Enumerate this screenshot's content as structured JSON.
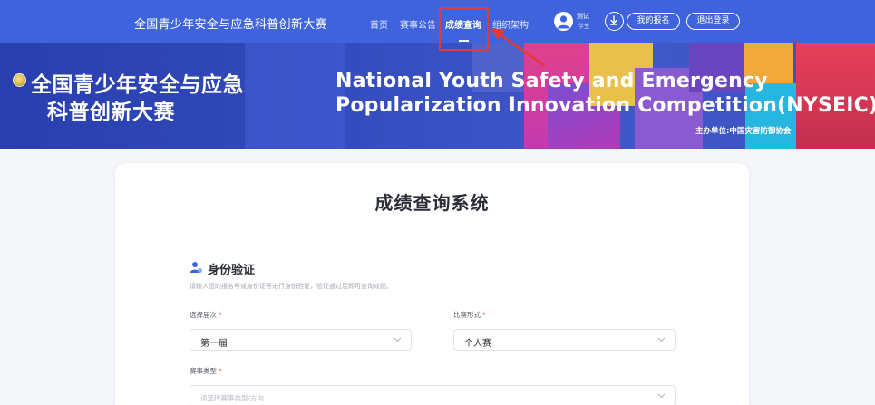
{
  "header": {
    "brand": "全国青少年安全与应急科普创新大赛",
    "nav": [
      {
        "label": "首页",
        "active": false
      },
      {
        "label": "赛事公告",
        "active": false
      },
      {
        "label": "成绩查询",
        "active": true
      },
      {
        "label": "组织架构",
        "active": false
      }
    ],
    "user": {
      "name": "测试",
      "role": "学生"
    },
    "buttons": {
      "my_registration": "我的报名",
      "logout": "退出登录"
    }
  },
  "banner": {
    "cn_title_line1": "全国青少年安全与应急",
    "cn_title_line2": "科普创新大赛",
    "en_title_line1": "National Youth Safety and Emergency",
    "en_title_line2": "Popularization Innovation Competition(NYSEIC)",
    "organizer": "主办单位:中国灾害防御协会"
  },
  "main": {
    "title": "成绩查询系统",
    "section": {
      "title": "身份验证",
      "description": "请输入您的报名号或身份证号进行身份验证，验证通过后即可查询成绩。"
    },
    "form": {
      "session": {
        "label": "选择届次",
        "required": "*",
        "value": "第一届"
      },
      "format": {
        "label": "比赛形式",
        "required": "*",
        "value": "个人赛"
      },
      "type": {
        "label": "赛事类型",
        "required": "*",
        "placeholder": "请选择赛事类型/方向"
      }
    }
  },
  "colors": {
    "nav_bg": "#3f63dd",
    "highlight": "#e53935",
    "required": "#e55353",
    "accent": "#3f63dd"
  }
}
